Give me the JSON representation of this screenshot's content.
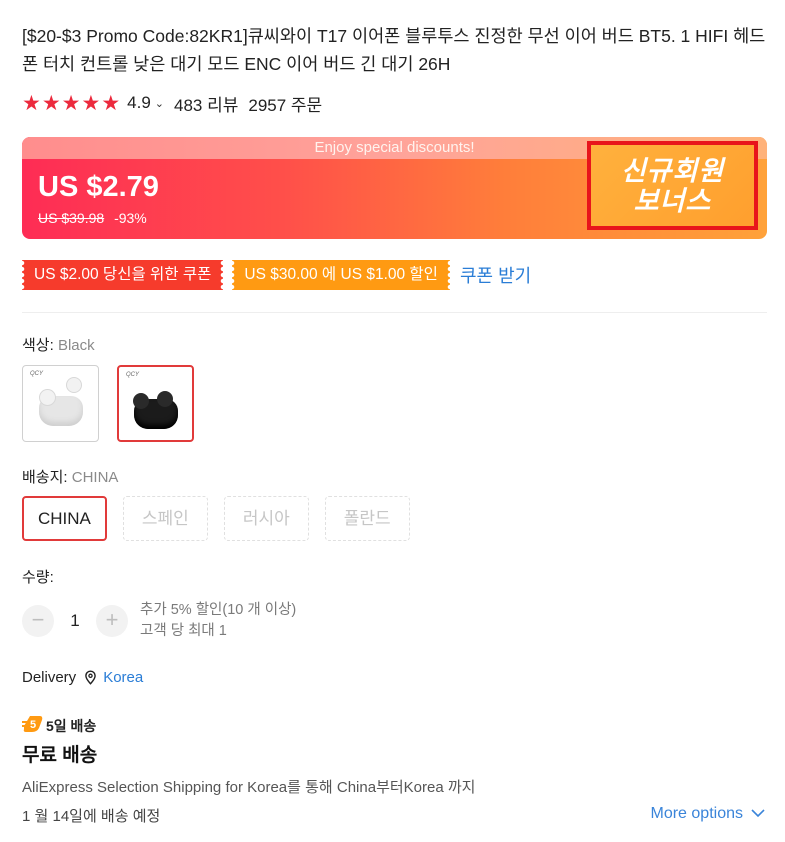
{
  "product": {
    "title": "[$20-$3 Promo Code:82KR1]큐씨와이 T17 이어폰 블루투스 진정한 무선 이어 버드 BT5. 1 HIFI 헤드폰 터치 컨트롤 낮은 대기 모드 ENC 이어 버드 긴 대기 26H",
    "rating": "4.9",
    "rating_stars": 5,
    "reviews": "483 리뷰",
    "orders": "2957 주문"
  },
  "price": {
    "banner_text": "Enjoy special discounts!",
    "current": "US $2.79",
    "original": "US $39.98",
    "discount": "-93%",
    "bonus_line1": "신규회원",
    "bonus_line2": "보너스"
  },
  "coupons": {
    "coupon1": "US $2.00 당신을 위한 쿠폰",
    "coupon2": "US $30.00 에 US $1.00 할인",
    "get_coupons": "쿠폰 받기"
  },
  "color": {
    "label": "색상:",
    "selected": "Black",
    "swatches": [
      {
        "name": "White",
        "tag": "QCY"
      },
      {
        "name": "Black",
        "tag": "QCY"
      }
    ]
  },
  "shipping_from": {
    "label": "배송지:",
    "selected": "CHINA",
    "options": [
      "CHINA",
      "스페인",
      "러시아",
      "폴란드"
    ]
  },
  "quantity": {
    "label": "수량:",
    "value": "1",
    "decrement": "−",
    "increment": "+",
    "note1": "추가 5% 할인(10 개 이상)",
    "note2": "고객 당 최대 1"
  },
  "delivery": {
    "label": "Delivery",
    "country": "Korea",
    "speed_badge": "5일 배송",
    "speed_num": "5",
    "free_shipping": "무료 배송",
    "route": "AliExpress Selection Shipping for Korea를 통해 China부터Korea 까지",
    "eta": "1 월 14일에 배송 예정",
    "more_options": "More options"
  },
  "colors": {
    "accent_red": "#ec2a3d",
    "link_blue": "#2a7dd6",
    "coupon_orange": "#ff9a12"
  }
}
